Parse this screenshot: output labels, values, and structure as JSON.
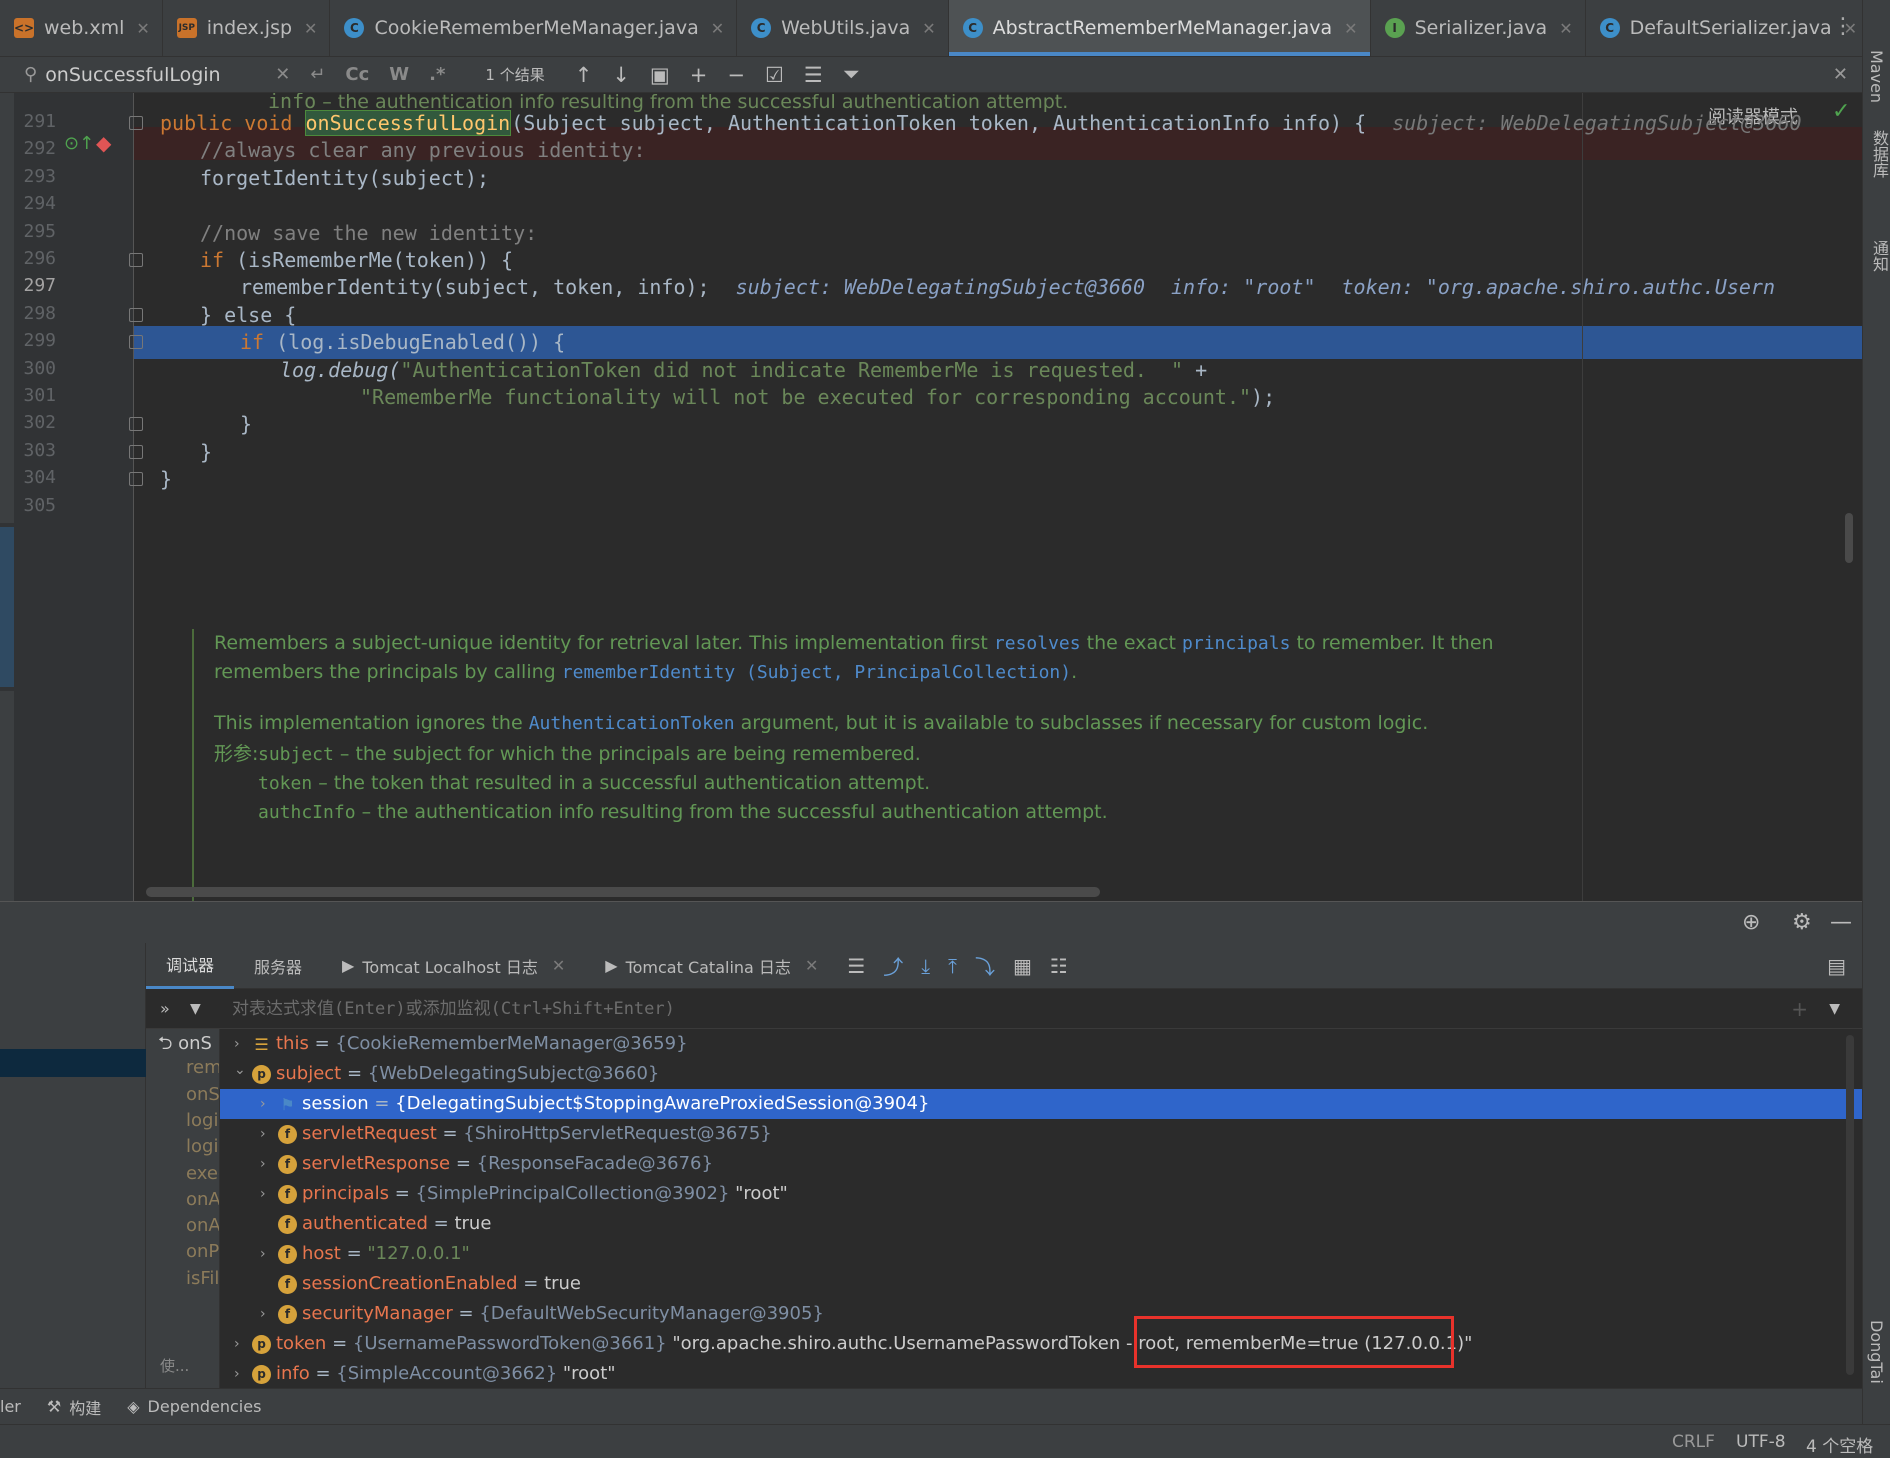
{
  "tabs": [
    {
      "label": "web.xml",
      "icon": "xml-file-icon",
      "type": "xml"
    },
    {
      "label": "index.jsp",
      "icon": "jsp-file-icon",
      "type": "jsp"
    },
    {
      "label": "CookieRememberMeManager.java",
      "icon": "class-icon",
      "type": "c"
    },
    {
      "label": "WebUtils.java",
      "icon": "class-icon",
      "type": "c"
    },
    {
      "label": "AbstractRememberMeManager.java",
      "icon": "abstract-class-icon",
      "type": "c",
      "active": true
    },
    {
      "label": "Serializer.java",
      "icon": "interface-icon",
      "type": "i"
    },
    {
      "label": "DefaultSerializer.java",
      "icon": "class-icon",
      "type": "c"
    }
  ],
  "right_strip": {
    "maven": "Maven",
    "database": "数据库",
    "notifications": "通知",
    "dongtai": "DongTai"
  },
  "search": {
    "value": "onSuccessfulLogin",
    "case_btn": "Cc",
    "word_btn": "W",
    "regex_btn": ".*",
    "result_count": "1 个结果"
  },
  "editor": {
    "reader_mode": "阅读器模式",
    "doc_prev_line": {
      "param": "info",
      "text": " – the authentication info resulting from the successful authentication attempt."
    },
    "lines": [
      {
        "num": "291",
        "p1": "public void ",
        "match": "onSuccessfulLogin",
        "p2": "(Subject subject, AuthenticationToken token, AuthenticationInfo info) {",
        "hint": "subject: WebDelegatingSubject@3660"
      },
      {
        "num": "292",
        "text": "//always clear any previous identity:"
      },
      {
        "num": "293",
        "text": "forgetIdentity(subject);"
      },
      {
        "num": "294",
        "text": ""
      },
      {
        "num": "295",
        "text": "//now save the new identity:"
      },
      {
        "num": "296",
        "kw": "if",
        "text": " (isRememberMe(token)) {"
      },
      {
        "num": "297",
        "text": "rememberIdentity(subject, token, info);",
        "hint1": "subject: WebDelegatingSubject@3660",
        "hint2": "info: \"root\"",
        "hint3": "token: \"org.apache.shiro.authc.Usern"
      },
      {
        "num": "298",
        "text": "} else {"
      },
      {
        "num": "299",
        "kw": "if",
        "text": " (log.isDebugEnabled()) {"
      },
      {
        "num": "300",
        "p1": "log.debug(",
        "str": "\"AuthenticationToken did not indicate RememberMe is requested.  \"",
        "p2": " +"
      },
      {
        "num": "301",
        "str": "\"RememberMe functionality will not be executed for corresponding account.\"",
        "p2": ");"
      },
      {
        "num": "302",
        "text": "}"
      },
      {
        "num": "303",
        "text": "}"
      },
      {
        "num": "304",
        "text": "}"
      },
      {
        "num": "305",
        "text": ""
      }
    ],
    "doc": {
      "p1_a": "Remembers a subject-unique identity for retrieval later. This implementation first ",
      "p1_ref1": "resolves",
      "p1_b": " the exact ",
      "p1_ref2": "principals",
      "p1_c": " to remember. It then remembers the principals by calling ",
      "p1_ref3": "rememberIdentity (Subject, PrincipalCollection)",
      "p1_d": ".",
      "p2_a": "This implementation ignores the ",
      "p2_ref": "AuthenticationToken",
      "p2_b": " argument, but it is available to subclasses if necessary for custom logic.",
      "params_label": "形参:",
      "params": [
        {
          "name": "subject",
          "text": " – the subject for which the principals are being remembered."
        },
        {
          "name": "token",
          "text": " – the token that resulted in a successful authentication attempt."
        },
        {
          "name": "authcInfo",
          "text": " – the authentication info resulting from the successful authentication attempt."
        }
      ]
    }
  },
  "debugger": {
    "tabs": [
      {
        "label": "调试器",
        "active": true
      },
      {
        "label": "服务器"
      },
      {
        "label": "Tomcat Localhost 日志",
        "closable": true
      },
      {
        "label": "Tomcat Catalina 日志",
        "closable": true
      }
    ],
    "eval_placeholder": "对表达式求值(Enter)或添加监视(Ctrl+Shift+Enter)",
    "frames": [
      "onS",
      "rem",
      "onS",
      "logi",
      "logi",
      "exec",
      "onA",
      "onA",
      "onP",
      "isFil"
    ],
    "frames_footer": "使...",
    "variables": [
      {
        "indent": 0,
        "arrow": "›",
        "icon": "list",
        "name": "this",
        "val": "{CookieRememberMeManager@3659}"
      },
      {
        "indent": 0,
        "arrow": "⌄",
        "icon": "p",
        "name": "subject",
        "val": "{WebDelegatingSubject@3660}"
      },
      {
        "indent": 1,
        "arrow": "›",
        "icon": "flag",
        "name": "session",
        "val": "{DelegatingSubject$StoppingAwareProxiedSession@3904}",
        "selected": true
      },
      {
        "indent": 1,
        "arrow": "›",
        "icon": "f",
        "name": "servletRequest",
        "val": "{ShiroHttpServletRequest@3675}"
      },
      {
        "indent": 1,
        "arrow": "›",
        "icon": "f",
        "name": "servletResponse",
        "val": "{ResponseFacade@3676}"
      },
      {
        "indent": 1,
        "arrow": "›",
        "icon": "f",
        "name": "principals",
        "val": "{SimplePrincipalCollection@3902}",
        "extra": " \"root\""
      },
      {
        "indent": 1,
        "arrow": "",
        "icon": "f",
        "name": "authenticated",
        "bool": "true"
      },
      {
        "indent": 1,
        "arrow": "›",
        "icon": "f",
        "name": "host",
        "str": "\"127.0.0.1\""
      },
      {
        "indent": 1,
        "arrow": "",
        "icon": "f",
        "name": "sessionCreationEnabled",
        "bool": "true"
      },
      {
        "indent": 1,
        "arrow": "›",
        "icon": "f",
        "name": "securityManager",
        "val": "{DefaultWebSecurityManager@3905}"
      },
      {
        "indent": 0,
        "arrow": "›",
        "icon": "p",
        "name": "token",
        "val": "{UsernamePasswordToken@3661}",
        "extra": " \"org.apache.shiro.authc.UsernamePasswordToken - root, rememberMe=true (127.0.0.1)\""
      },
      {
        "indent": 0,
        "arrow": "›",
        "icon": "p",
        "name": "info",
        "val": "{SimpleAccount@3662}",
        "extra": " \"root\""
      }
    ]
  },
  "bottom_toolbar": {
    "first": "ler",
    "build": "构建",
    "dependencies": "Dependencies"
  },
  "status": {
    "line_sep": "CRLF",
    "encoding": "UTF-8",
    "indent": "4 个空格"
  },
  "colors": {
    "accent": "#4a88c7",
    "selection": "#2f65ca",
    "highlight_box": "#e8322b",
    "keyword": "#cc7832",
    "string": "#6a8759"
  }
}
